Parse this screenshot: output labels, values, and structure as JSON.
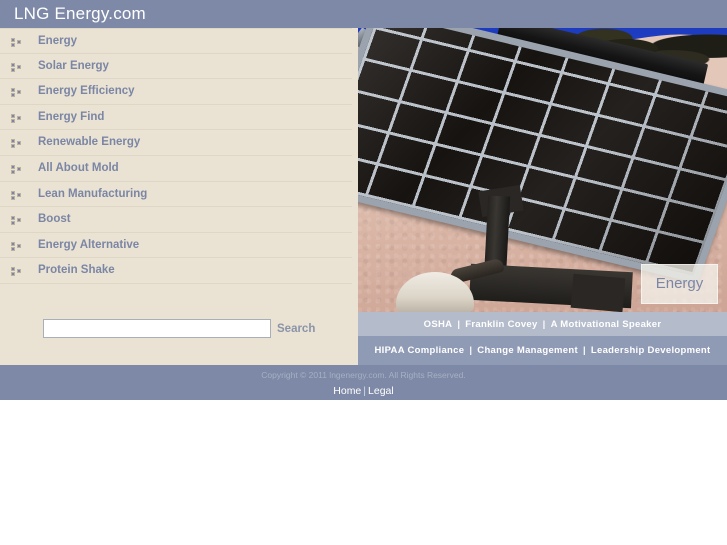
{
  "header": {
    "title": "LNG Energy.com",
    "bg_color": "#7d89a6"
  },
  "sidebar": {
    "bg_color": "#eae3d3",
    "bullet_icon": "list-bullet-icon",
    "items": [
      {
        "label": "Energy"
      },
      {
        "label": "Solar Energy"
      },
      {
        "label": "Energy Efficiency"
      },
      {
        "label": "Energy Find"
      },
      {
        "label": "Renewable Energy"
      },
      {
        "label": "All About Mold"
      },
      {
        "label": "Lean Manufacturing"
      },
      {
        "label": "Boost"
      },
      {
        "label": "Energy Alternative"
      },
      {
        "label": "Protein Shake"
      }
    ]
  },
  "search": {
    "value": "",
    "placeholder": "",
    "button_label": "Search"
  },
  "hero": {
    "image_alt": "solar-panel-photo",
    "badge_label": "Energy"
  },
  "link_bands": [
    {
      "bg_color": "#b4bbcb",
      "links": [
        "OSHA",
        "Franklin Covey",
        "A Motivational Speaker"
      ],
      "separator": "|"
    },
    {
      "bg_color": "#8f9ab4",
      "links": [
        "HIPAA Compliance",
        "Change Management",
        "Leadership Development"
      ],
      "separator": "|"
    }
  ],
  "footer": {
    "bg_color": "#7d89a6",
    "copyright": "Copyright © 2011 lngenergy.com. All Rights Reserved.",
    "links": [
      "Home",
      "Legal"
    ],
    "separator": "|"
  }
}
